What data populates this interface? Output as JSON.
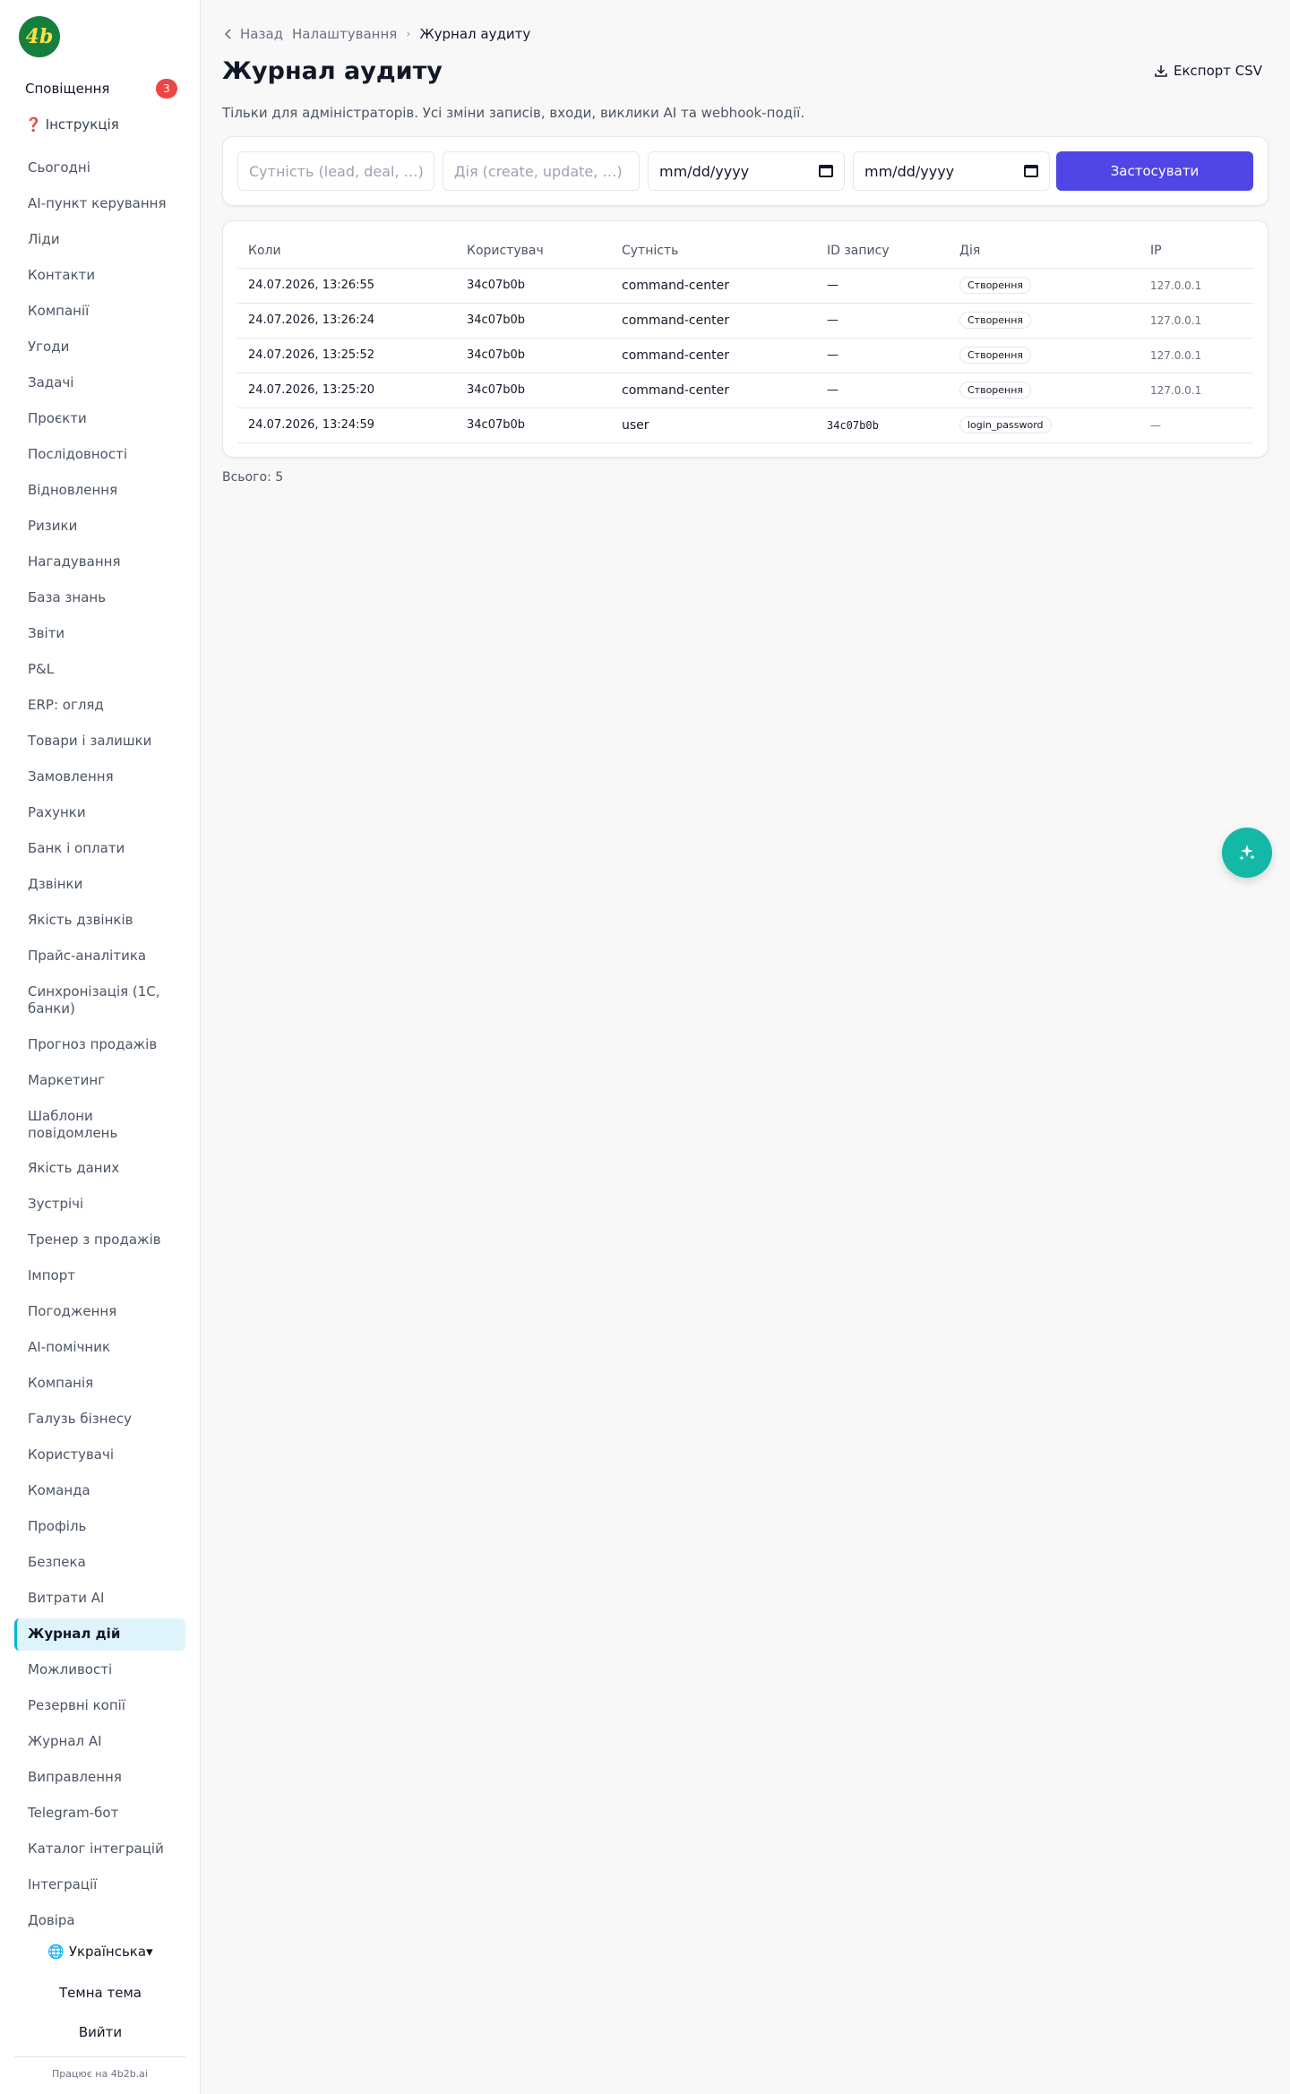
{
  "sidebar": {
    "logo_text": "4b",
    "notifications": {
      "label": "Сповіщення",
      "count": "3"
    },
    "guide": {
      "icon": "❓",
      "label": "Інструкція"
    },
    "items": [
      "Сьогодні",
      "AI-пункт керування",
      "Ліди",
      "Контакти",
      "Компанії",
      "Угоди",
      "Задачі",
      "Проєкти",
      "Послідовності",
      "Відновлення",
      "Ризики",
      "Нагадування",
      "База знань",
      "Звіти",
      "P&L",
      "ERP: огляд",
      "Товари і залишки",
      "Замовлення",
      "Рахунки",
      "Банк і оплати",
      "Дзвінки",
      "Якість дзвінків",
      "Прайс-аналітика",
      "Синхронізація (1С, банки)",
      "Прогноз продажів",
      "Маркетинг",
      "Шаблони повідомлень",
      "Якість даних",
      "Зустрічі",
      "Тренер з продажів",
      "Імпорт",
      "Погодження",
      "AI-помічник",
      "Компанія",
      "Галузь бізнесу",
      "Користувачі",
      "Команда",
      "Профіль",
      "Безпека",
      "Витрати AI",
      "Журнал дій",
      "Можливості",
      "Резервні копії",
      "Журнал AI",
      "Виправлення",
      "Telegram-бот",
      "Каталог інтеграцій",
      "Інтеграції",
      "Довіра"
    ],
    "active_item": "Журнал дій",
    "language": "🌐 Українська▾",
    "theme": "Темна тема",
    "logout": "Вийти",
    "powered_by": "Працює на 4b2b.ai"
  },
  "breadcrumb": {
    "back": "Назад",
    "parent": "Налаштування",
    "current": "Журнал аудиту"
  },
  "page": {
    "title": "Журнал аудиту",
    "export": "Експорт CSV",
    "subtitle": "Тільки для адміністраторів. Усі зміни записів, входи, виклики AI та webhook-події."
  },
  "filters": {
    "entity_placeholder": "Сутність (lead, deal, …)",
    "action_placeholder": "Дія (create, update, …)",
    "date_from": "mm/dd/yyyy",
    "date_to": "mm/dd/yyyy",
    "apply": "Застосувати"
  },
  "table": {
    "headers": [
      "Коли",
      "Користувач",
      "Сутність",
      "ID запису",
      "Дія",
      "IP"
    ],
    "rows": [
      {
        "when": "24.07.2026, 13:26:55",
        "user": "34c07b0b",
        "entity": "command-center",
        "record_id": "—",
        "action": "Створення",
        "ip": "127.0.0.1"
      },
      {
        "when": "24.07.2026, 13:26:24",
        "user": "34c07b0b",
        "entity": "command-center",
        "record_id": "—",
        "action": "Створення",
        "ip": "127.0.0.1"
      },
      {
        "when": "24.07.2026, 13:25:52",
        "user": "34c07b0b",
        "entity": "command-center",
        "record_id": "—",
        "action": "Створення",
        "ip": "127.0.0.1"
      },
      {
        "when": "24.07.2026, 13:25:20",
        "user": "34c07b0b",
        "entity": "command-center",
        "record_id": "—",
        "action": "Створення",
        "ip": "127.0.0.1"
      },
      {
        "when": "24.07.2026, 13:24:59",
        "user": "34c07b0b",
        "entity": "user",
        "record_id": "34c07b0b",
        "action": "login_password",
        "ip": "—"
      }
    ]
  },
  "total": "Всього: 5",
  "colors": {
    "accent": "#4f46e5",
    "fab": "#14b8a6",
    "badge": "#ef4444",
    "active_bg": "#dff3fa"
  }
}
